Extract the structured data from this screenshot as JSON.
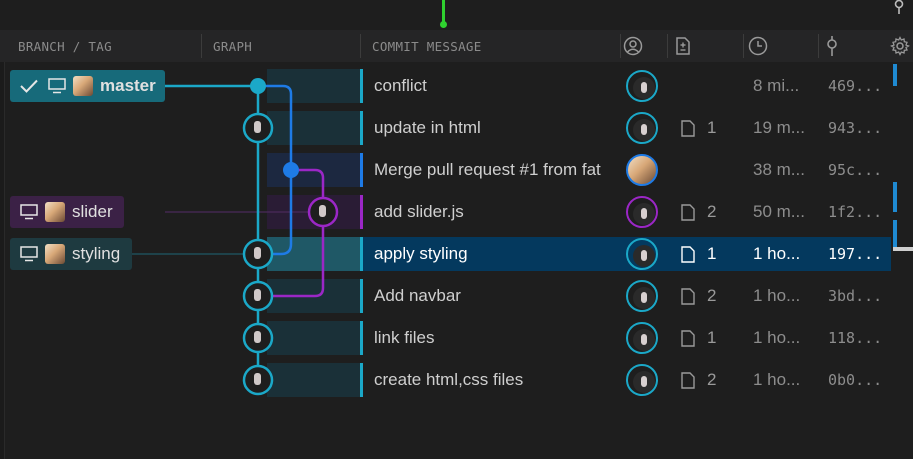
{
  "header": {
    "branch_tag": "BRANCH / TAG",
    "graph": "GRAPH",
    "commit_message": "COMMIT MESSAGE"
  },
  "colors": {
    "lane_master": "#1ba8c8",
    "lane_blue": "#1e7be6",
    "lane_purple": "#9b27c6",
    "selected_row": "#04395e"
  },
  "branches": [
    {
      "name": "master",
      "icons": [
        "check-icon",
        "monitor-icon",
        "avatar"
      ]
    },
    {
      "name": "slider",
      "icons": [
        "monitor-icon",
        "avatar"
      ]
    },
    {
      "name": "styling",
      "icons": [
        "monitor-icon",
        "avatar"
      ]
    }
  ],
  "commits": [
    {
      "message": "conflict",
      "changes": "",
      "time": "8 mi...",
      "sha": "469..."
    },
    {
      "message": "update in html",
      "changes": "1",
      "time": "19 m...",
      "sha": "943..."
    },
    {
      "message": "Merge pull request #1 from fat",
      "changes": "",
      "time": "38 m...",
      "sha": "95c..."
    },
    {
      "message": "add slider.js",
      "changes": "2",
      "time": "50 m...",
      "sha": "1f2..."
    },
    {
      "message": "apply styling",
      "changes": "1",
      "time": "1 ho...",
      "sha": "197..."
    },
    {
      "message": "Add navbar",
      "changes": "2",
      "time": "1 ho...",
      "sha": "3bd..."
    },
    {
      "message": "link files",
      "changes": "1",
      "time": "1 ho...",
      "sha": "118..."
    },
    {
      "message": "create html,css files",
      "changes": "2",
      "time": "1 ho...",
      "sha": "0b0..."
    }
  ]
}
